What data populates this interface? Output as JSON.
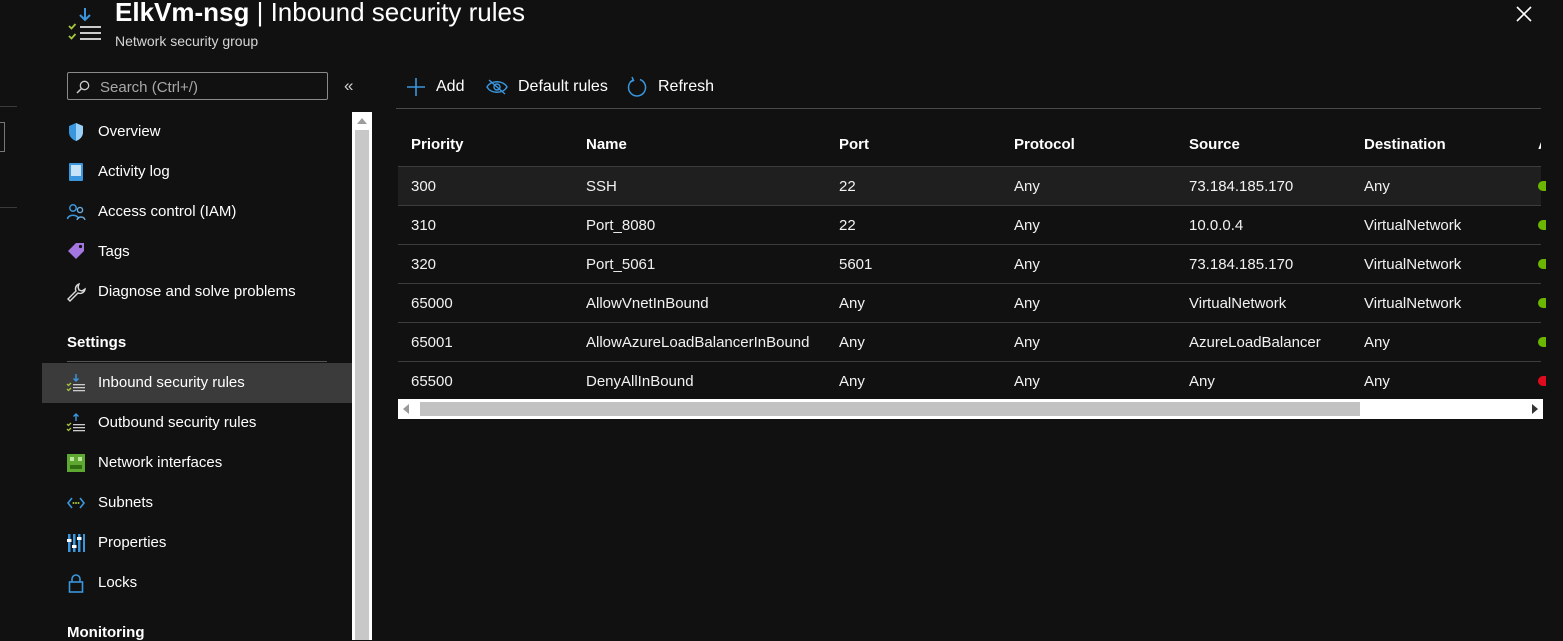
{
  "header": {
    "title_bold": "ElkVm-nsg",
    "title_rest": " | Inbound security rules",
    "subtitle": "Network security group"
  },
  "sidebar": {
    "search_placeholder": "Search (Ctrl+/)",
    "collapse_glyph": "«",
    "items": [
      {
        "label": "Overview",
        "icon": "shield-icon"
      },
      {
        "label": "Activity log",
        "icon": "activity-log-icon"
      },
      {
        "label": "Access control (IAM)",
        "icon": "people-icon"
      },
      {
        "label": "Tags",
        "icon": "tag-icon"
      },
      {
        "label": "Diagnose and solve problems",
        "icon": "wrench-icon"
      }
    ],
    "settings_title": "Settings",
    "settings_items": [
      {
        "label": "Inbound security rules",
        "icon": "inbound-rules-icon",
        "active": true
      },
      {
        "label": "Outbound security rules",
        "icon": "outbound-rules-icon"
      },
      {
        "label": "Network interfaces",
        "icon": "network-interface-icon"
      },
      {
        "label": "Subnets",
        "icon": "subnet-icon"
      },
      {
        "label": "Properties",
        "icon": "properties-icon"
      },
      {
        "label": "Locks",
        "icon": "lock-icon"
      }
    ],
    "monitoring_title": "Monitoring"
  },
  "toolbar": {
    "add": "Add",
    "default_rules": "Default rules",
    "refresh": "Refresh"
  },
  "table": {
    "columns": [
      "Priority",
      "Name",
      "Port",
      "Protocol",
      "Source",
      "Destination",
      "A"
    ],
    "rows": [
      {
        "priority": "300",
        "name": "SSH",
        "port": "22",
        "protocol": "Any",
        "source": "73.184.185.170",
        "destination": "Any",
        "action": "allow"
      },
      {
        "priority": "310",
        "name": "Port_8080",
        "port": "22",
        "protocol": "Any",
        "source": "10.0.0.4",
        "destination": "VirtualNetwork",
        "action": "allow"
      },
      {
        "priority": "320",
        "name": "Port_5061",
        "port": "5601",
        "protocol": "Any",
        "source": "73.184.185.170",
        "destination": "VirtualNetwork",
        "action": "allow"
      },
      {
        "priority": "65000",
        "name": "AllowVnetInBound",
        "port": "Any",
        "protocol": "Any",
        "source": "VirtualNetwork",
        "destination": "VirtualNetwork",
        "action": "allow"
      },
      {
        "priority": "65001",
        "name": "AllowAzureLoadBalancerInBound",
        "port": "Any",
        "protocol": "Any",
        "source": "AzureLoadBalancer",
        "destination": "Any",
        "action": "allow"
      },
      {
        "priority": "65500",
        "name": "DenyAllInBound",
        "port": "Any",
        "protocol": "Any",
        "source": "Any",
        "destination": "Any",
        "action": "deny"
      }
    ]
  },
  "colors": {
    "allow": "#6bb700",
    "deny": "#e00b1c",
    "accent": "#3a96dd"
  }
}
